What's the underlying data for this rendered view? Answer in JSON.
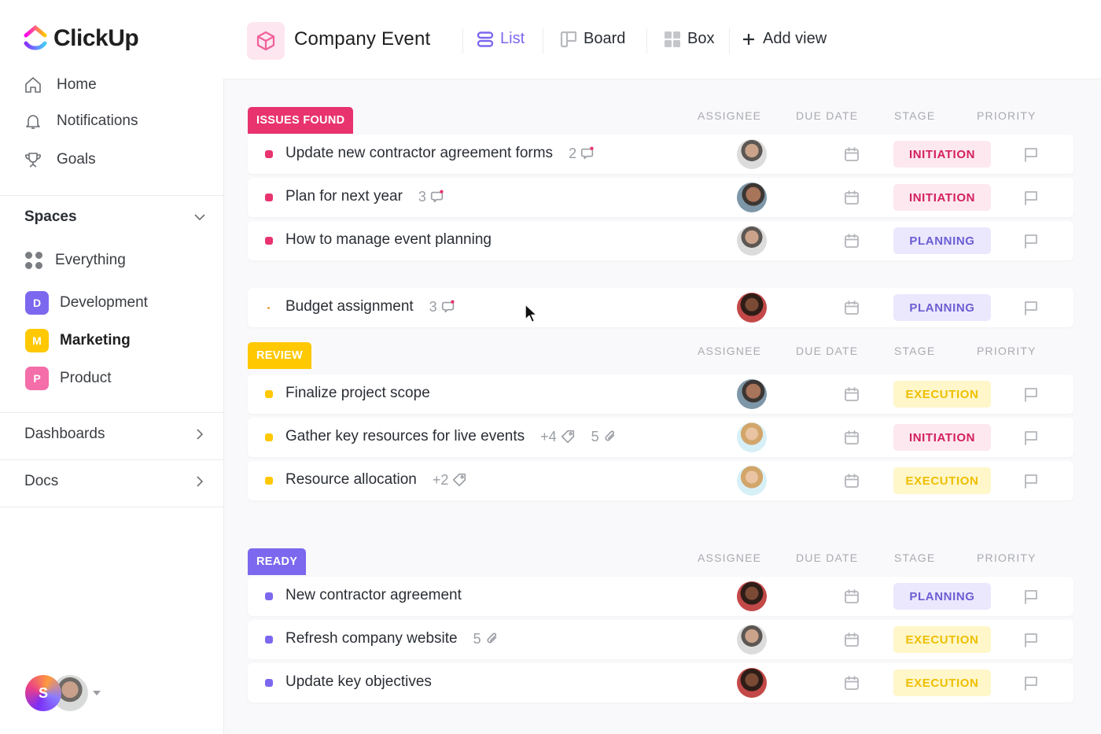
{
  "app": {
    "brand": "ClickUp"
  },
  "sidebar": {
    "nav": [
      {
        "label": "Home",
        "icon": "home-icon"
      },
      {
        "label": "Notifications",
        "icon": "bell-icon"
      },
      {
        "label": "Goals",
        "icon": "trophy-icon"
      }
    ],
    "spaces_label": "Spaces",
    "everything_label": "Everything",
    "spaces": [
      {
        "letter": "D",
        "label": "Development",
        "color": "#7b68ee"
      },
      {
        "letter": "M",
        "label": "Marketing",
        "color": "#ffc800"
      },
      {
        "letter": "P",
        "label": "Product",
        "color": "#f46ea9"
      }
    ],
    "dashboards_label": "Dashboards",
    "docs_label": "Docs",
    "user_initial": "S"
  },
  "header": {
    "title": "Company Event",
    "views": [
      {
        "label": "List",
        "active": true
      },
      {
        "label": "Board",
        "active": false
      },
      {
        "label": "Box",
        "active": false
      }
    ],
    "add_view_label": "Add view"
  },
  "columns": {
    "assignee": "ASSIGNEE",
    "due_date": "DUE DATE",
    "stage": "STAGE",
    "priority": "PRIORITY"
  },
  "stage_colors": {
    "INITIATION": {
      "bg": "#fde8ef",
      "fg": "#d3205f"
    },
    "PLANNING": {
      "bg": "#ebe8fd",
      "fg": "#6c5dd3"
    },
    "EXECUTION": {
      "bg": "#fff6c9",
      "fg": "#eebf00"
    }
  },
  "groups": [
    {
      "label": "ISSUES FOUND",
      "color": "#e8336f",
      "tasks": [
        {
          "name": "Update new contractor agreement forms",
          "comments": "2",
          "stage": "INITIATION"
        },
        {
          "name": "Plan for next year",
          "comments": "3",
          "stage": "INITIATION"
        },
        {
          "name": "How to manage event planning",
          "stage": "PLANNING"
        },
        {
          "name": "Budget assignment",
          "comments": "3",
          "stage": "PLANNING"
        }
      ]
    },
    {
      "label": "REVIEW",
      "color": "#ffc800",
      "tasks": [
        {
          "name": "Finalize project scope",
          "stage": "EXECUTION"
        },
        {
          "name": "Gather key resources for live events",
          "tags": "+4",
          "attachments": "5",
          "stage": "INITIATION"
        },
        {
          "name": "Resource allocation",
          "tags": "+2",
          "stage": "EXECUTION"
        }
      ]
    },
    {
      "label": "READY",
      "color": "#7b68ee",
      "tasks": [
        {
          "name": "New contractor agreement",
          "stage": "PLANNING"
        },
        {
          "name": "Refresh company website",
          "attachments": "5",
          "stage": "EXECUTION"
        },
        {
          "name": "Update key objectives",
          "stage": "EXECUTION"
        }
      ]
    }
  ]
}
